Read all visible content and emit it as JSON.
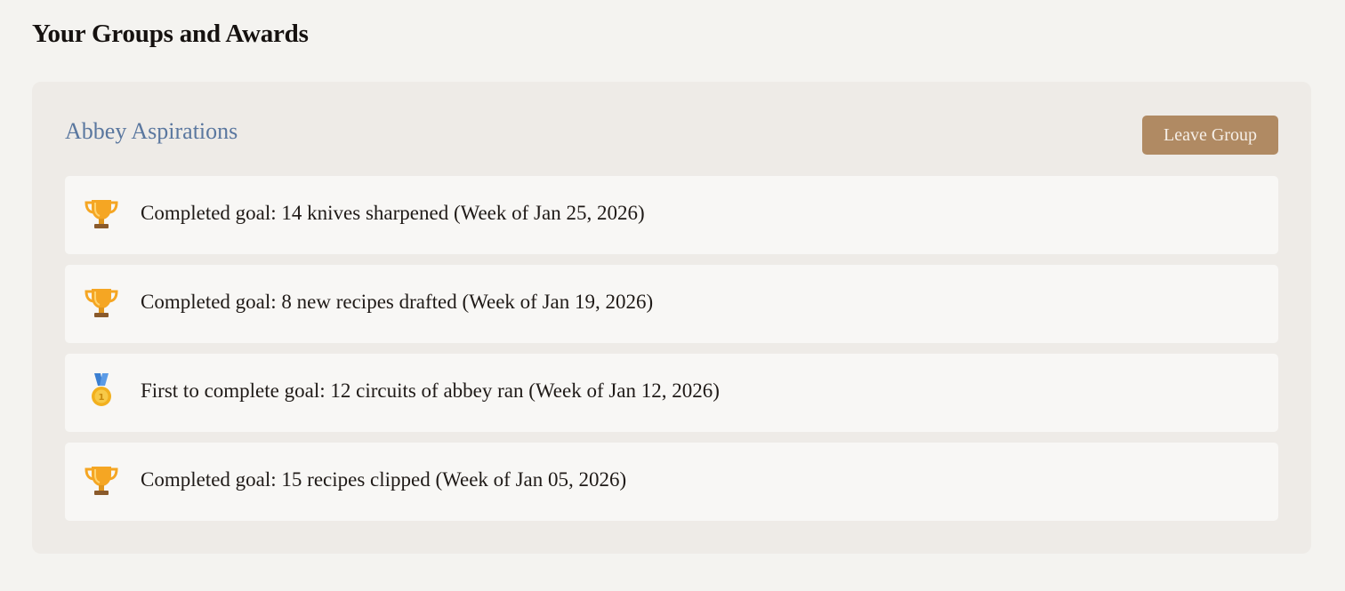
{
  "page": {
    "title": "Your Groups and Awards"
  },
  "group": {
    "name": "Abbey Aspirations",
    "leave_label": "Leave Group"
  },
  "awards": [
    {
      "icon": "trophy-icon",
      "text": "Completed goal: 14 knives sharpened (Week of Jan 25, 2026)"
    },
    {
      "icon": "trophy-icon",
      "text": "Completed goal: 8 new recipes drafted (Week of Jan 19, 2026)"
    },
    {
      "icon": "medal-icon",
      "text": "First to complete goal: 12 circuits of abbey ran (Week of Jan 12, 2026)"
    },
    {
      "icon": "trophy-icon",
      "text": "Completed goal: 15 recipes clipped (Week of Jan 05, 2026)"
    }
  ],
  "colors": {
    "background": "#f4f3f0",
    "card": "#eeebe7",
    "item": "#f8f7f5",
    "group_name": "#5a779f",
    "button": "#b08a63",
    "trophy": "#f5a623",
    "medal": "#f2b01e",
    "ribbon": "#3b7fd1"
  }
}
